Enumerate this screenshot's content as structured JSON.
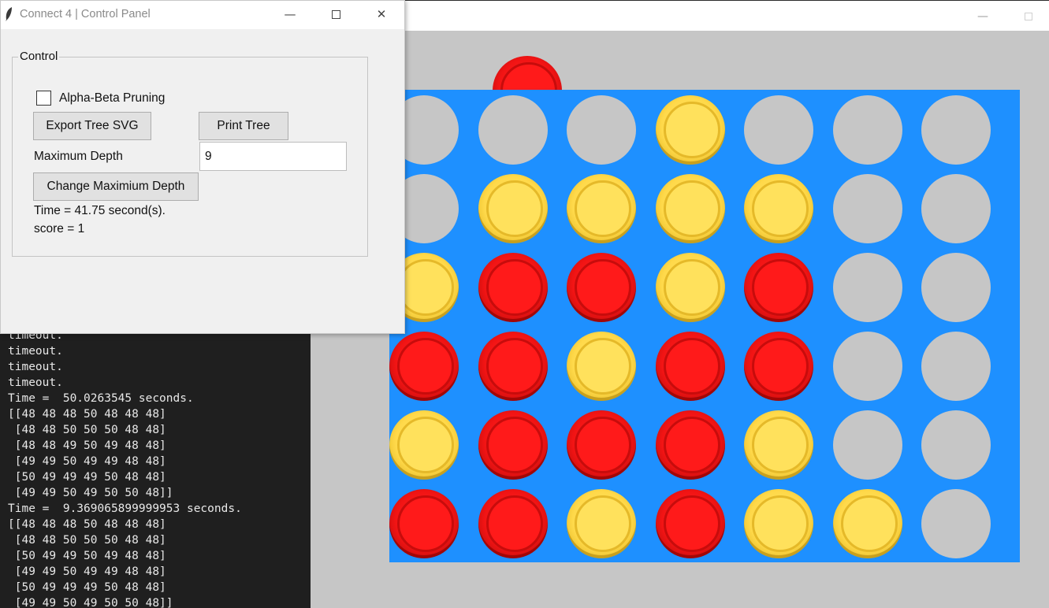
{
  "control_panel": {
    "title": "Connect 4 | Control Panel",
    "group_label": "Control",
    "alpha_beta_label": "Alpha-Beta Pruning",
    "alpha_beta_checked": false,
    "export_button": "Export Tree SVG",
    "print_button": "Print Tree",
    "max_depth_label": "Maximum Depth",
    "max_depth_value": "9",
    "change_button": "Change Maximium Depth",
    "time_text": "Time = 41.75 second(s).",
    "score_text": "score = 1",
    "icons": {
      "app": "feather-icon",
      "minimize": "minimize-icon",
      "maximize": "maximize-icon",
      "close": "close-icon"
    }
  },
  "console_lines": [
    "timeout.",
    "timeout.",
    "timeout.",
    "timeout.",
    "Time =  50.0263545 seconds.",
    "[[48 48 48 50 48 48 48]",
    " [48 48 50 50 50 48 48]",
    " [48 48 49 50 49 48 48]",
    " [49 49 50 49 49 48 48]",
    " [50 49 49 49 50 48 48]",
    " [49 49 50 49 50 50 48]]",
    "Time =  9.369065899999953 seconds.",
    "[[48 48 48 50 48 48 48]",
    " [48 48 50 50 50 48 48]",
    " [50 49 49 50 49 48 48]",
    " [49 49 50 49 49 48 48]",
    " [50 49 49 49 50 48 48]",
    " [49 49 50 49 50 50 48]]"
  ],
  "board": {
    "hover_disc": {
      "column": 1,
      "color": "red"
    },
    "rows": [
      [
        "empty",
        "empty",
        "empty",
        "yellow",
        "empty",
        "empty",
        "empty"
      ],
      [
        "empty",
        "yellow",
        "yellow",
        "yellow",
        "yellow",
        "empty",
        "empty"
      ],
      [
        "yellow",
        "red",
        "red",
        "yellow",
        "red",
        "empty",
        "empty"
      ],
      [
        "red",
        "red",
        "yellow",
        "red",
        "red",
        "empty",
        "empty"
      ],
      [
        "yellow",
        "red",
        "red",
        "red",
        "yellow",
        "empty",
        "empty"
      ],
      [
        "red",
        "red",
        "yellow",
        "red",
        "yellow",
        "yellow",
        "empty"
      ]
    ],
    "colors": {
      "board": "#1e90ff",
      "red": "#f21414",
      "yellow": "#ffd94a",
      "empty": "#c6c6c6"
    }
  }
}
